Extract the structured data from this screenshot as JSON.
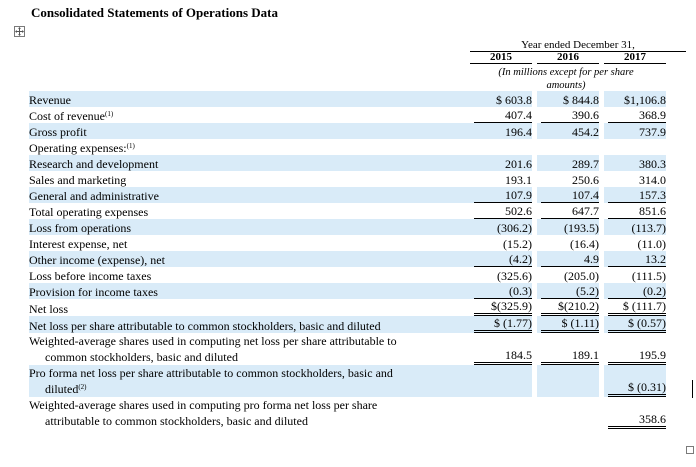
{
  "title": "Consolidated Statements of Operations Data",
  "header": {
    "period": "Year ended December 31,",
    "years": [
      "2015",
      "2016",
      "2017"
    ],
    "units_note": "(In millions except for per share amounts)"
  },
  "rows": [
    {
      "label": "Revenue",
      "sup": "",
      "indent": false,
      "shade": true,
      "values": [
        "$ 603.8",
        "$ 844.8",
        "$1,106.8"
      ],
      "underline": ""
    },
    {
      "label": "Cost of revenue",
      "sup": "(1)",
      "indent": true,
      "shade": false,
      "values": [
        "407.4",
        "390.6",
        "368.9"
      ],
      "underline": "single"
    },
    {
      "label": "Gross profit",
      "sup": "",
      "indent": false,
      "shade": true,
      "values": [
        "196.4",
        "454.2",
        "737.9"
      ],
      "underline": ""
    },
    {
      "label": "Operating expenses:",
      "sup": "(1)",
      "indent": false,
      "shade": false,
      "values": [
        "",
        "",
        ""
      ],
      "underline": ""
    },
    {
      "label": "Research and development",
      "sup": "",
      "indent": true,
      "shade": true,
      "values": [
        "201.6",
        "289.7",
        "380.3"
      ],
      "underline": ""
    },
    {
      "label": "Sales and marketing",
      "sup": "",
      "indent": true,
      "shade": false,
      "values": [
        "193.1",
        "250.6",
        "314.0"
      ],
      "underline": ""
    },
    {
      "label": "General and administrative",
      "sup": "",
      "indent": true,
      "shade": true,
      "values": [
        "107.9",
        "107.4",
        "157.3"
      ],
      "underline": "single"
    },
    {
      "label": "Total operating expenses",
      "sup": "",
      "indent": false,
      "shade": false,
      "values": [
        "502.6",
        "647.7",
        "851.6"
      ],
      "underline": "single"
    },
    {
      "label": "Loss from operations",
      "sup": "",
      "indent": false,
      "shade": true,
      "values": [
        "(306.2)",
        "(193.5)",
        "(113.7)"
      ],
      "underline": ""
    },
    {
      "label": "Interest expense, net",
      "sup": "",
      "indent": false,
      "shade": false,
      "values": [
        "(15.2)",
        "(16.4)",
        "(11.0)"
      ],
      "underline": ""
    },
    {
      "label": "Other income (expense), net",
      "sup": "",
      "indent": false,
      "shade": true,
      "values": [
        "(4.2)",
        "4.9",
        "13.2"
      ],
      "underline": "single"
    },
    {
      "label": "Loss before income taxes",
      "sup": "",
      "indent": false,
      "shade": false,
      "values": [
        "(325.6)",
        "(205.0)",
        "(111.5)"
      ],
      "underline": ""
    },
    {
      "label": "Provision for income taxes",
      "sup": "",
      "indent": false,
      "shade": true,
      "values": [
        "(0.3)",
        "(5.2)",
        "(0.2)"
      ],
      "underline": "single"
    },
    {
      "label": "Net loss",
      "sup": "",
      "indent": false,
      "shade": false,
      "values": [
        "$(325.9)",
        "$(210.2)",
        "$ (111.7)"
      ],
      "underline": "double"
    },
    {
      "label": "Net loss per share attributable to common stockholders, basic and diluted",
      "sup": "",
      "indent": false,
      "shade": true,
      "values": [
        "$ (1.77)",
        "$ (1.11)",
        "$ (0.57)"
      ],
      "underline": "double"
    }
  ],
  "multi_rows": [
    {
      "line1": "Weighted-average shares used in computing net loss per share attributable to",
      "line2": "common stockholders, basic and diluted",
      "sup": "",
      "shade": false,
      "values": [
        "184.5",
        "189.1",
        "195.9"
      ],
      "underline": "double"
    },
    {
      "line1": "Pro forma net loss per share attributable to common stockholders, basic and",
      "line2": "diluted",
      "sup": "(2)",
      "shade": true,
      "values": [
        "",
        "",
        "$ (0.31)"
      ],
      "underline": "double"
    },
    {
      "line1": "Weighted-average shares used in computing pro forma net loss per share",
      "line2": "attributable to common stockholders, basic and diluted",
      "sup": "",
      "shade": false,
      "values": [
        "",
        "",
        "358.6"
      ],
      "underline": "double"
    }
  ]
}
